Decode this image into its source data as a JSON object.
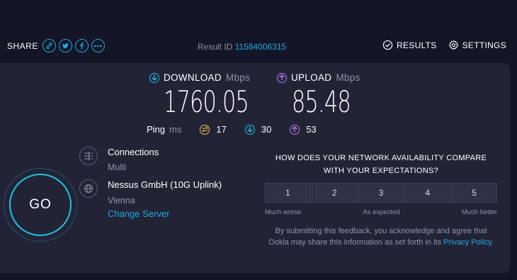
{
  "share": {
    "label": "SHARE",
    "buttons": [
      "link",
      "twitter",
      "facebook",
      "more"
    ]
  },
  "result": {
    "label": "Result ID",
    "id": "11584006315"
  },
  "header": {
    "results_label": "RESULTS",
    "settings_label": "SETTINGS"
  },
  "download": {
    "label": "DOWNLOAD",
    "unit": "Mbps",
    "value": "1760.05"
  },
  "upload": {
    "label": "UPLOAD",
    "unit": "Mbps",
    "value": "85.48"
  },
  "ping": {
    "label": "Ping",
    "unit": "ms",
    "idle": "17",
    "download": "30",
    "upload": "53"
  },
  "go": {
    "label": "GO"
  },
  "connections": {
    "title": "Connections",
    "value": "Multi"
  },
  "server": {
    "name": "Nessus GmbH (10G Uplink)",
    "location": "Vienna",
    "change_label": "Change Server"
  },
  "survey": {
    "question": "HOW DOES YOUR NETWORK AVAILABILITY COMPARE WITH YOUR EXPECTATIONS?",
    "options": [
      "1",
      "2",
      "3",
      "4",
      "5"
    ],
    "low_label": "Much worse",
    "mid_label": "As expected",
    "high_label": "Much better",
    "disclaimer_prefix": "By submitting this feedback, you acknowledge and agree that Ookla may share this information as set forth in its ",
    "privacy_link": "Privacy Policy",
    "disclaimer_suffix": "."
  },
  "colors": {
    "background": "#141526",
    "card": "#222436",
    "accent_blue": "#1fa8e0",
    "download_cyan": "#1fc1e8",
    "upload_purple": "#b57cf2",
    "ping_yellow": "#f2c94c"
  }
}
